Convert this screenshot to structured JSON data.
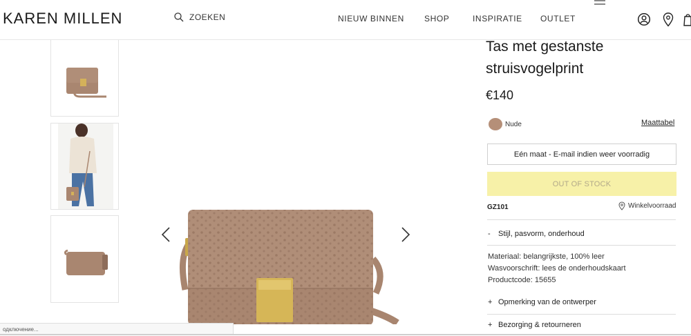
{
  "header": {
    "logo": "KAREN MILLEN",
    "search_label": "ZOEKEN",
    "nav": [
      "NIEUW BINNEN",
      "SHOP",
      "INSPIRATIE",
      "OUTLET"
    ],
    "icons": [
      "account-icon",
      "location-pin-icon",
      "bag-icon"
    ]
  },
  "product": {
    "title": "Tas met gestanste struisvogelprint",
    "price": "€140",
    "color_name": "Nude",
    "color_hex": "#b58f78",
    "size_chart": "Maattabel",
    "size_button": "Eén maat - E-mail indien weer voorradig",
    "stock_button": "OUT OF STOCK",
    "code": "GZ101",
    "store_link": "Winkelvoorraad"
  },
  "accordion": {
    "section1_symbol": "-",
    "section1_title": "Stijl, pasvorm, onderhoud",
    "details": [
      "Materiaal: belangrijkste, 100% leer",
      "Wasvoorschrift: lees de onderhoudskaart",
      "Productcode: 15655"
    ],
    "section2_symbol": "+",
    "section2_title": "Opmerking van de ontwerper",
    "section3_symbol": "+",
    "section3_title": "Bezorging & retourneren"
  },
  "status_bar": "одключение...",
  "colors": {
    "accent_yellow": "#f7f1a8",
    "bag_taupe": "#a98670"
  }
}
